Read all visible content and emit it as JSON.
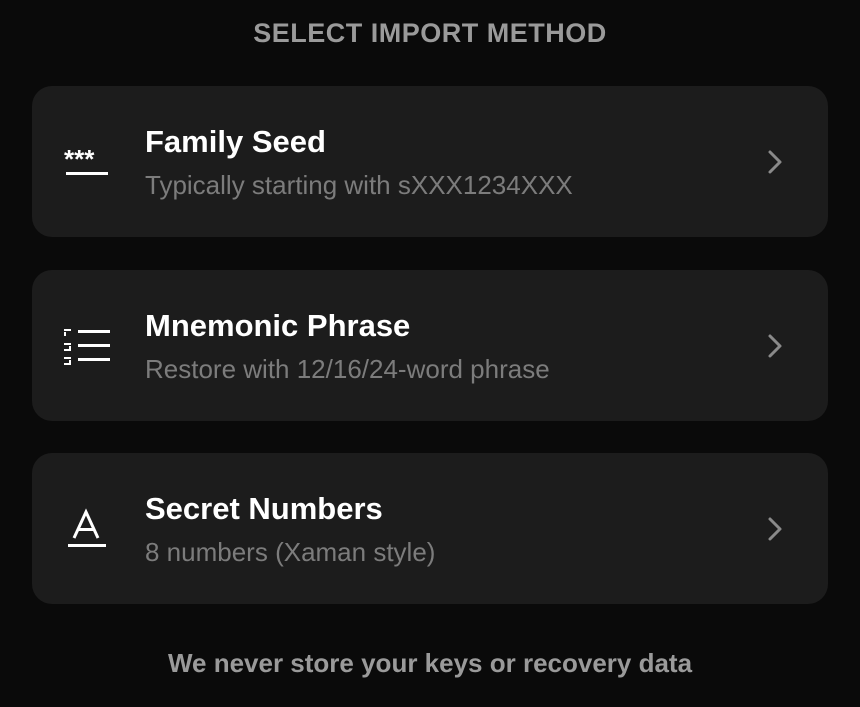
{
  "header": {
    "title": "SELECT IMPORT METHOD"
  },
  "methods": [
    {
      "title": "Family Seed",
      "subtitle": "Typically starting with sXXX1234XXX",
      "icon": "password-asterisks-icon"
    },
    {
      "title": "Mnemonic Phrase",
      "subtitle": "Restore with 12/16/24-word phrase",
      "icon": "numbered-list-icon"
    },
    {
      "title": "Secret Numbers",
      "subtitle": "8 numbers (Xaman style)",
      "icon": "letter-a-icon"
    }
  ],
  "footer": {
    "note": "We never store your keys or recovery data"
  },
  "colors": {
    "background": "#0a0a0a",
    "card": "#1c1c1c",
    "title": "#ffffff",
    "subtitle": "#7c7c7c",
    "muted": "#9a9a9a"
  }
}
